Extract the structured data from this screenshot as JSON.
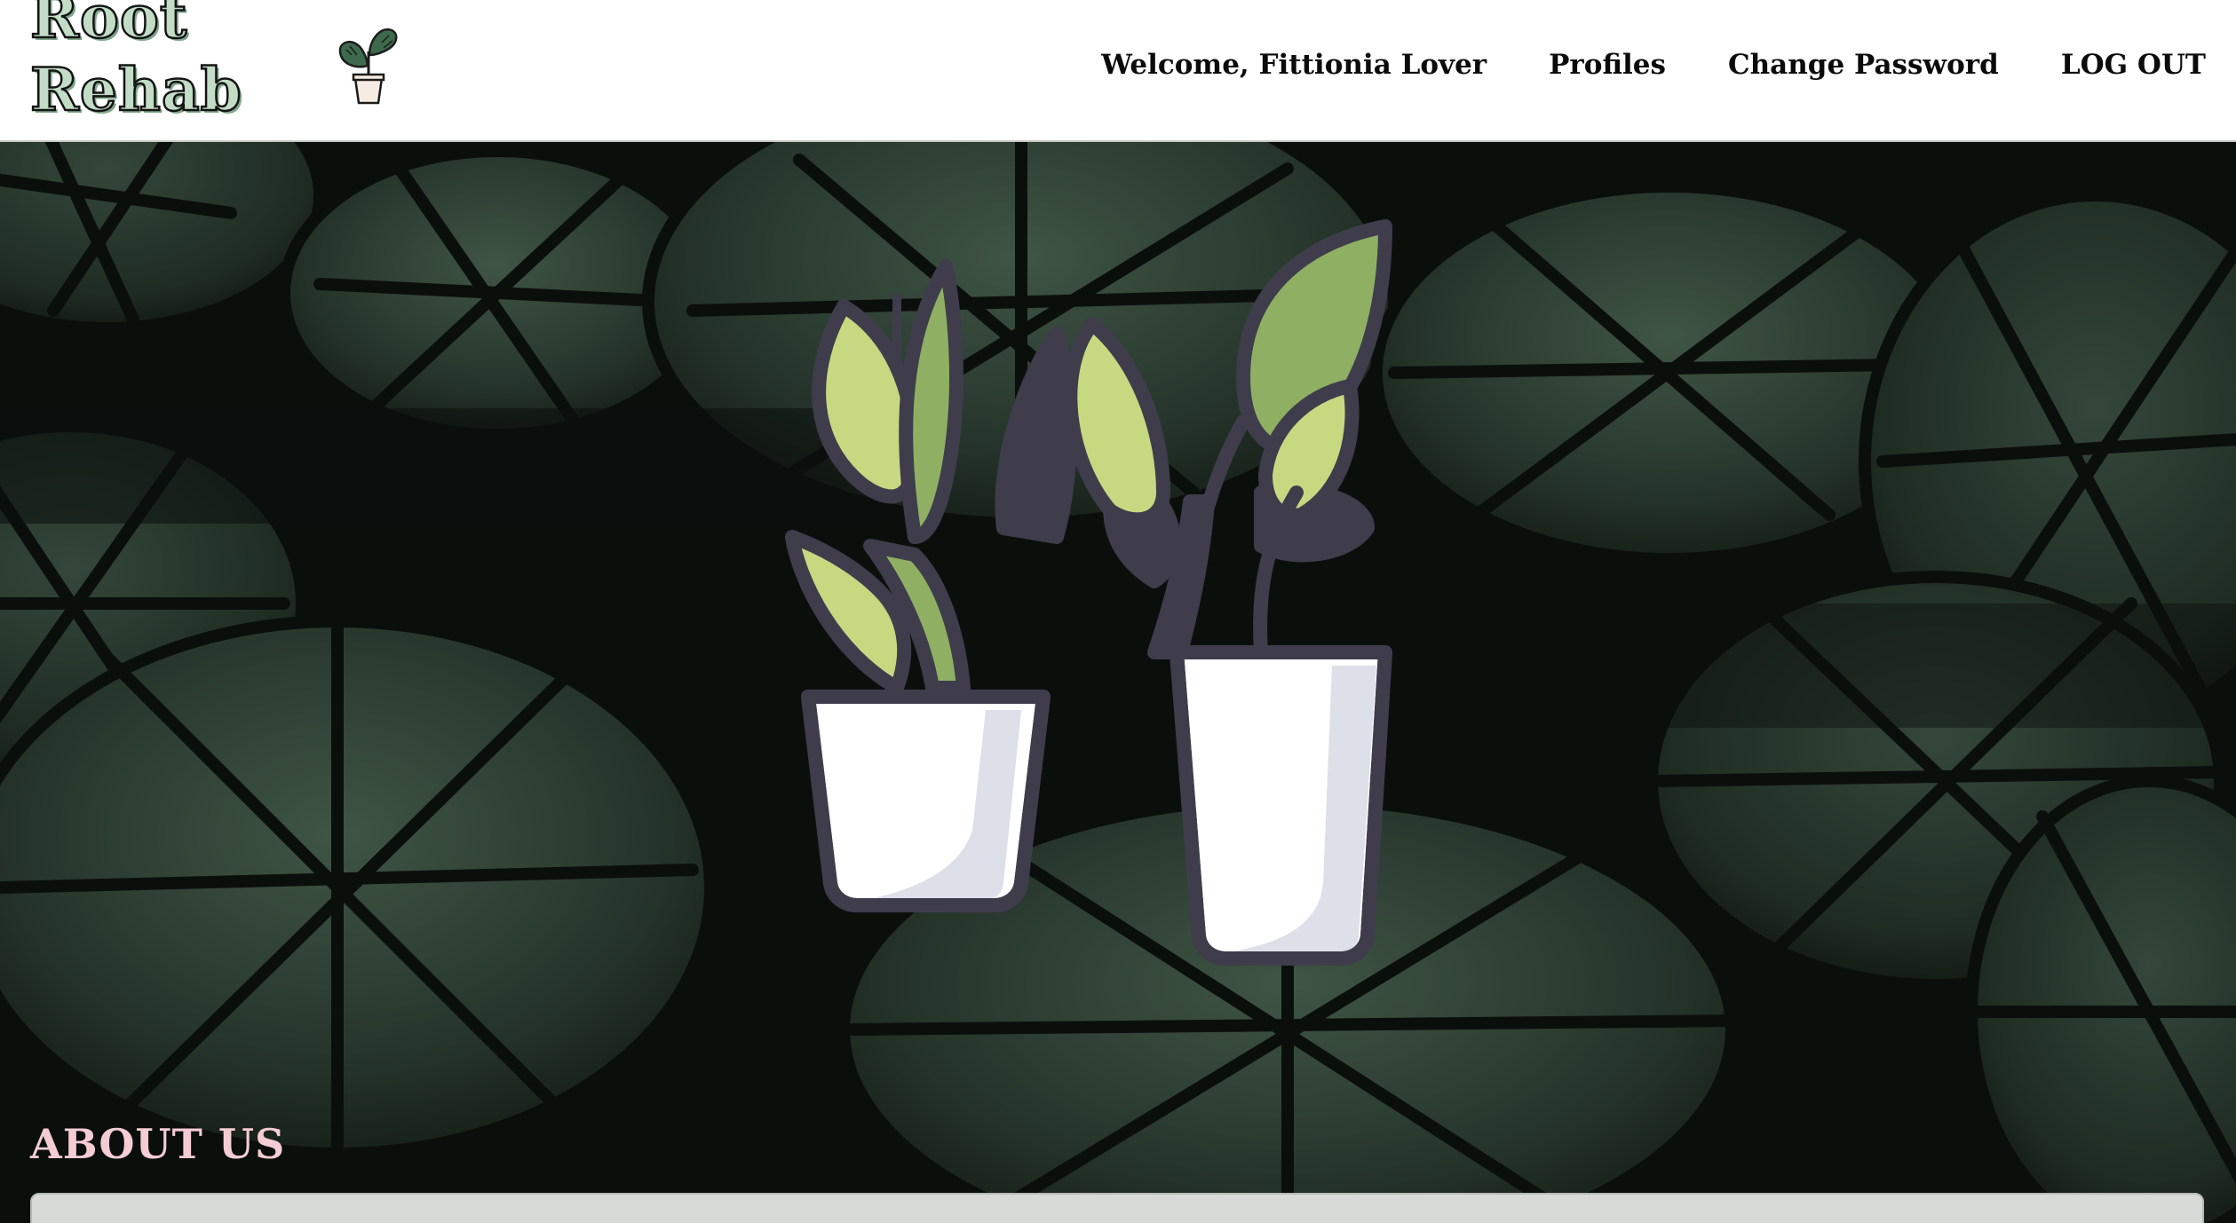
{
  "brand": {
    "line1": "Root",
    "line2": "Rehab",
    "logo_icon": "potted-plant-icon"
  },
  "nav": {
    "welcome": "Welcome, Fittionia Lover",
    "profiles": "Profiles",
    "change_password": "Change Password",
    "logout": "LOG OUT"
  },
  "hero": {
    "background": "monstera-leaves-image",
    "illustration": "two-potted-plants-illustration"
  },
  "about": {
    "heading": "ABOUT US"
  },
  "colors": {
    "brand_fill": "#c2dcc6",
    "brand_shadow": "#7fa58a",
    "about_heading": "#f4cdd3",
    "leaf_light": "#c6d981",
    "leaf_mid": "#8fb063",
    "outline_dark": "#3f3d4c",
    "pot_white": "#ffffff",
    "pot_shade": "#dde0e8"
  }
}
